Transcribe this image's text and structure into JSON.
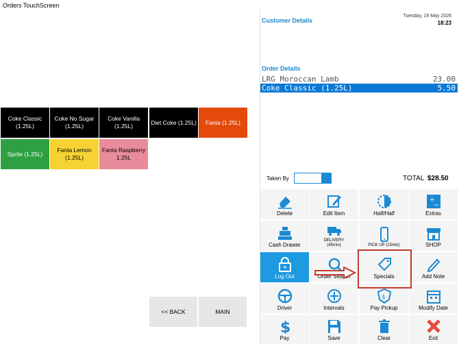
{
  "window": {
    "title": "Orders TouchScreen"
  },
  "products": [
    {
      "label": "Coke Classic (1.25L)",
      "color": "#000000"
    },
    {
      "label": "Coke No Sugar (1.25L)",
      "color": "#000000"
    },
    {
      "label": "Coke Vanilla (1.25L)",
      "color": "#000000"
    },
    {
      "label": "Diet Coke (1.25L)",
      "color": "#000000"
    },
    {
      "label": "Fanta (1.25L)",
      "color": "#e34a0c"
    },
    {
      "label": "Sprite (1.25L)",
      "color": "#2ea043"
    },
    {
      "label": "Fanta Lemon (1.25L)",
      "color": "#f6d333"
    },
    {
      "label": "Fanta Raspberry 1.25L",
      "color": "#e98b9a"
    }
  ],
  "nav": {
    "back": "<< BACK",
    "main": "MAIN"
  },
  "header": {
    "date": "Tuesday, 19 May 2026",
    "time": "18:23"
  },
  "customer": {
    "heading": "Customer Details"
  },
  "order": {
    "heading": "Order Details",
    "items": [
      {
        "name": "LRG Moroccan Lamb",
        "price": "23.00",
        "selected": false
      },
      {
        "name": "Coke Classic (1.25L)",
        "price": "5.50",
        "selected": true
      }
    ]
  },
  "taken_by": {
    "label": "Taken By",
    "value": ""
  },
  "total": {
    "label": "TOTAL",
    "value": "$28.50"
  },
  "functions": {
    "delete": "Delete",
    "edit_item": "Edit Item",
    "half_half": "Half/Half",
    "extras": "Extras",
    "cash_drawer": "Cash Drawer",
    "delivery": "DELIVERY (45min)",
    "pickup": "PICK UP (15min)",
    "shop": "SHOP",
    "logout": "Log Out",
    "order_search": "Order Search",
    "specials": "Specials",
    "add_note": "Add Note",
    "driver": "Driver",
    "intervals": "Intervals",
    "pay_pickup": "Pay Pickup",
    "modify_date": "Modify Date",
    "pay": "Pay",
    "save": "Save",
    "clear": "Clear",
    "exit": "Exit"
  },
  "colors": {
    "accent": "#1e9ae0",
    "selection": "#0a79d6",
    "highlight": "#c0392b",
    "icon": "#1b8ad3"
  }
}
